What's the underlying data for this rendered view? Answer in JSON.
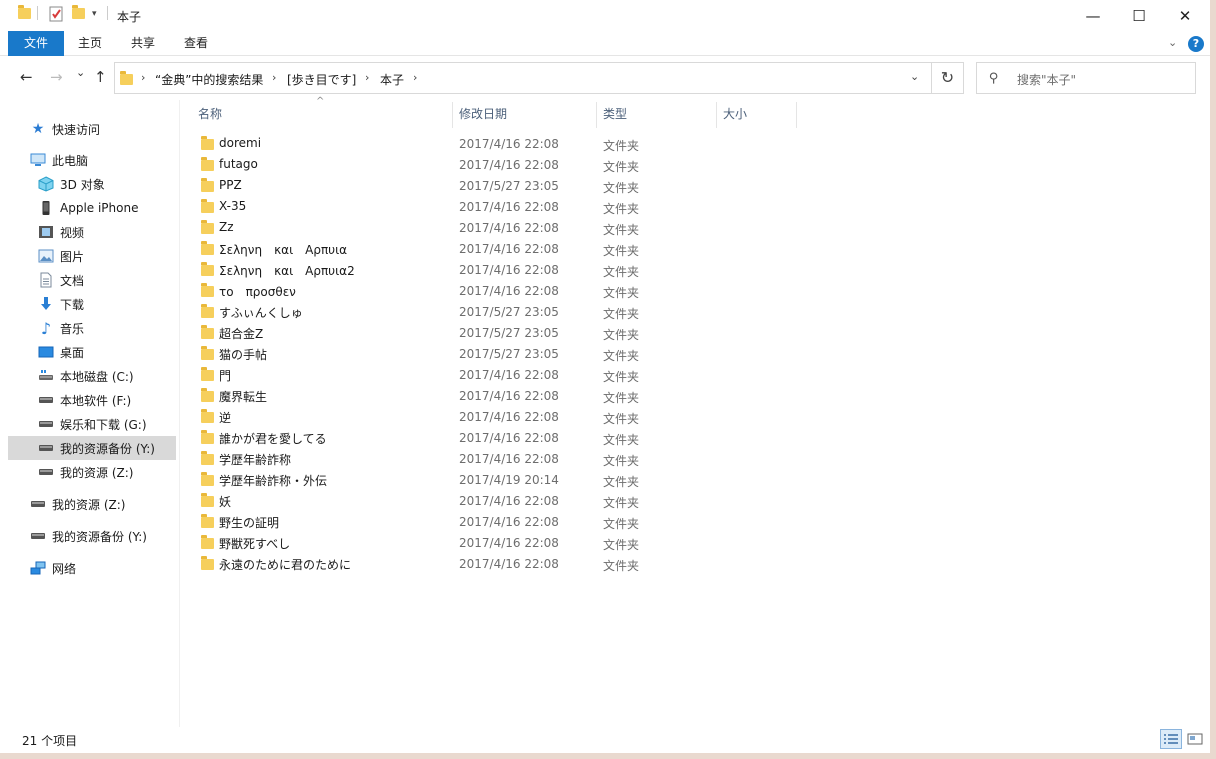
{
  "window": {
    "title": "本子"
  },
  "titlebar": {
    "minimize": "—",
    "maximize": "☐",
    "close": "✕"
  },
  "ribbon": {
    "tabs": [
      "文件",
      "主页",
      "共享",
      "查看"
    ],
    "help": "?"
  },
  "nav": {
    "back": "←",
    "forward": "→",
    "recent": "⌄",
    "up": "↑"
  },
  "address": {
    "crumbs": [
      "“金典”中的搜索结果",
      "[歩き目です]",
      "本子"
    ],
    "separator": "›",
    "dropdown": "⌄",
    "refresh": "↻"
  },
  "search": {
    "placeholder": "搜索\"本子\""
  },
  "sidebar": {
    "items": [
      {
        "label": "快速访问",
        "icon": "star-icon"
      },
      {
        "label": "此电脑",
        "icon": "computer-icon"
      },
      {
        "label": "3D 对象",
        "icon": "3d-objects-icon"
      },
      {
        "label": "Apple iPhone",
        "icon": "phone-icon"
      },
      {
        "label": "视频",
        "icon": "video-icon"
      },
      {
        "label": "图片",
        "icon": "pictures-icon"
      },
      {
        "label": "文档",
        "icon": "documents-icon"
      },
      {
        "label": "下载",
        "icon": "download-icon"
      },
      {
        "label": "音乐",
        "icon": "music-icon"
      },
      {
        "label": "桌面",
        "icon": "desktop-icon"
      },
      {
        "label": "本地磁盘 (C:)",
        "icon": "local-disk-icon"
      },
      {
        "label": "本地软件 (F:)",
        "icon": "drive-icon"
      },
      {
        "label": "娱乐和下载 (G:)",
        "icon": "drive-icon"
      },
      {
        "label": "我的资源备份 (Y:)",
        "icon": "drive-icon"
      },
      {
        "label": "我的资源 (Z:)",
        "icon": "drive-icon"
      },
      {
        "label": "我的资源 (Z:)",
        "icon": "drive-icon"
      },
      {
        "label": "我的资源备份 (Y:)",
        "icon": "drive-icon"
      },
      {
        "label": "网络",
        "icon": "network-icon"
      }
    ]
  },
  "columns": {
    "name": "名称",
    "modified": "修改日期",
    "type": "类型",
    "size": "大小"
  },
  "files": [
    {
      "name": "doremi",
      "modified": "2017/4/16 22:08",
      "type": "文件夹"
    },
    {
      "name": "futago",
      "modified": "2017/4/16 22:08",
      "type": "文件夹"
    },
    {
      "name": "PPZ",
      "modified": "2017/5/27 23:05",
      "type": "文件夹"
    },
    {
      "name": "X-35",
      "modified": "2017/4/16 22:08",
      "type": "文件夹"
    },
    {
      "name": "Zz",
      "modified": "2017/4/16 22:08",
      "type": "文件夹"
    },
    {
      "name": "Σεληνη　και　Αρπυια",
      "modified": "2017/4/16 22:08",
      "type": "文件夹"
    },
    {
      "name": "Σεληνη　και　Αρπυια2",
      "modified": "2017/4/16 22:08",
      "type": "文件夹"
    },
    {
      "name": "το　προσθεν",
      "modified": "2017/4/16 22:08",
      "type": "文件夹"
    },
    {
      "name": "すふぃんくしゅ",
      "modified": "2017/5/27 23:05",
      "type": "文件夹"
    },
    {
      "name": "超合金Z",
      "modified": "2017/5/27 23:05",
      "type": "文件夹"
    },
    {
      "name": "猫の手帖",
      "modified": "2017/5/27 23:05",
      "type": "文件夹"
    },
    {
      "name": "門",
      "modified": "2017/4/16 22:08",
      "type": "文件夹"
    },
    {
      "name": "魔界転生",
      "modified": "2017/4/16 22:08",
      "type": "文件夹"
    },
    {
      "name": "逆",
      "modified": "2017/4/16 22:08",
      "type": "文件夹"
    },
    {
      "name": "誰かが君を愛してる",
      "modified": "2017/4/16 22:08",
      "type": "文件夹"
    },
    {
      "name": "学歴年齢詐称",
      "modified": "2017/4/16 22:08",
      "type": "文件夹"
    },
    {
      "name": "学歴年齢詐称・外伝",
      "modified": "2017/4/19 20:14",
      "type": "文件夹"
    },
    {
      "name": "妖",
      "modified": "2017/4/16 22:08",
      "type": "文件夹"
    },
    {
      "name": "野生の証明",
      "modified": "2017/4/16 22:08",
      "type": "文件夹"
    },
    {
      "name": "野獣死すべし",
      "modified": "2017/4/16 22:08",
      "type": "文件夹"
    },
    {
      "name": "永遠のために君のために",
      "modified": "2017/4/16 22:08",
      "type": "文件夹"
    }
  ],
  "status": {
    "count": "21 个项目"
  },
  "colors": {
    "accent": "#1979ca",
    "folder": "#f6cf5c",
    "selected": "#d9d9d9"
  }
}
